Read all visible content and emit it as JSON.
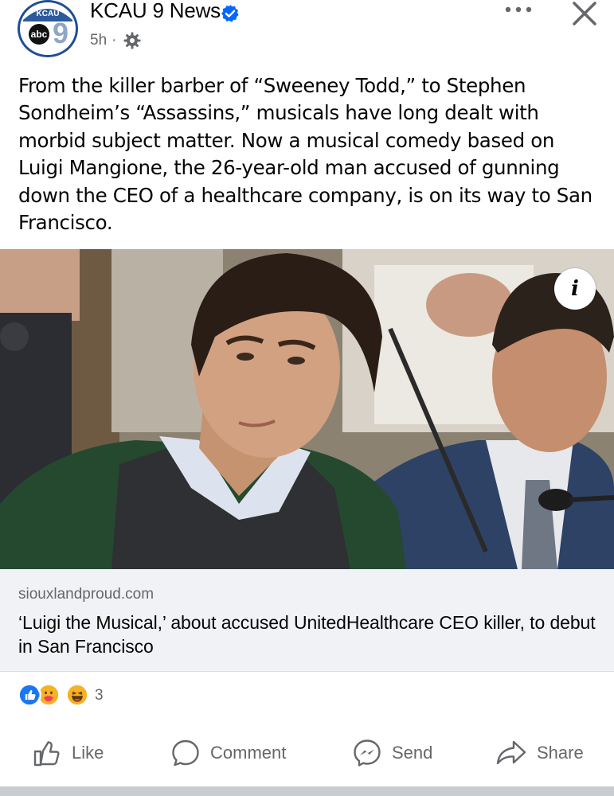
{
  "post": {
    "page_name": "KCAU 9 News",
    "timestamp": "5h",
    "separator": "·",
    "text": "From the killer barber of “Sweeney Todd,” to Stephen Sondheim’s “Assassins,” musicals have long dealt with morbid subject matter. Now a musical comedy based on Luigi Mangione, the 26-year-old man accused of gunning down the CEO of a healthcare company, is on its way to San Francisco."
  },
  "avatar": {
    "top_text": "KCAU",
    "logo_text": "abc",
    "number": "9"
  },
  "photo": {
    "info_label": "i"
  },
  "link": {
    "domain": "siouxlandproud.com",
    "title": "‘Luigi the Musical,’ about accused UnitedHealthcare CEO killer, to debut in San Francisco"
  },
  "reactions": {
    "count": "3",
    "types": [
      "like",
      "care",
      "haha"
    ]
  },
  "actions": {
    "like": "Like",
    "comment": "Comment",
    "send": "Send",
    "share": "Share"
  },
  "colors": {
    "verified": "#0866ff",
    "muted": "#65676b",
    "link_bg": "#f0f2f5",
    "like_blue": "#1877f2"
  },
  "icons": [
    "verified-badge-icon",
    "globe-gear-icon",
    "more-icon",
    "close-icon",
    "info-icon",
    "like-icon",
    "comment-icon",
    "messenger-icon",
    "share-icon"
  ]
}
